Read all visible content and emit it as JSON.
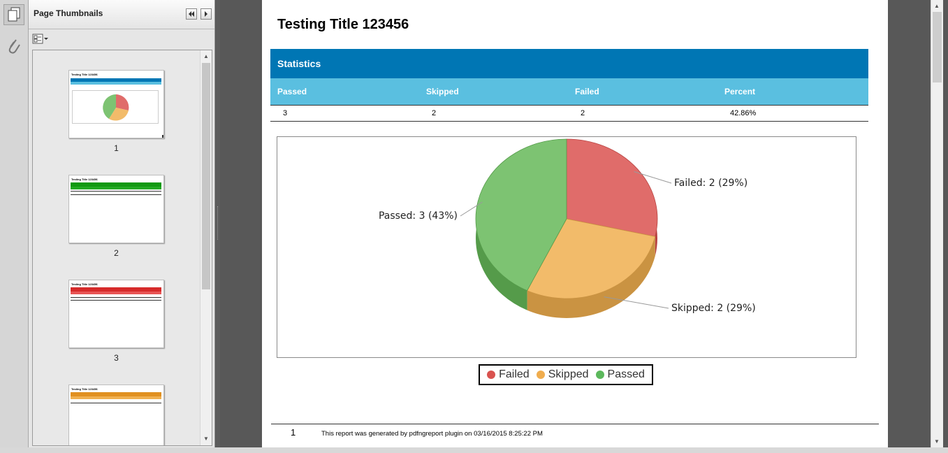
{
  "sidebar": {
    "title": "Page Thumbnails",
    "thumbnails": [
      {
        "label": "1",
        "title": "Testing Title 123456",
        "band": "Statistics",
        "accent": "#0076b4"
      },
      {
        "label": "2",
        "title": "Testing Title 123456",
        "band": "Passed",
        "accent": "#119911"
      },
      {
        "label": "3",
        "title": "Testing Title 123456",
        "band": "Failed",
        "accent": "#d62b2b"
      },
      {
        "label": "",
        "title": "Testing Title 123456",
        "band": "Skipped",
        "accent": "#e09020"
      }
    ]
  },
  "document": {
    "title": "Testing Title 123456",
    "stats_header": "Statistics",
    "columns": [
      "Passed",
      "Skipped",
      "Failed",
      "Percent"
    ],
    "row": [
      "3",
      "2",
      "2",
      "42.86%"
    ],
    "footer_page": "1",
    "footer_text": "This report was generated by pdfngreport plugin  on 03/16/2015 8:25:22 PM"
  },
  "chart_data": {
    "type": "pie",
    "labels": [
      "Failed",
      "Skipped",
      "Passed"
    ],
    "values": [
      2,
      2,
      3
    ],
    "slice_labels": [
      "Failed: 2 (29%)",
      "Skipped: 2 (29%)",
      "Passed: 3 (43%)"
    ],
    "colors": [
      "#e06c6a",
      "#f2bb6a",
      "#7dc372"
    ],
    "legend": [
      "Failed",
      "Skipped",
      "Passed"
    ],
    "legend_placement": "bottom"
  },
  "colors": {
    "header_blue": "#0076b4",
    "column_blue": "#5abfe0"
  },
  "icons": {
    "rail": [
      "pages-icon",
      "attachment-icon"
    ],
    "panel_toolbar": "options-menu-icon",
    "collapse": "double-left-arrow-icon",
    "next": "right-arrow-icon"
  }
}
